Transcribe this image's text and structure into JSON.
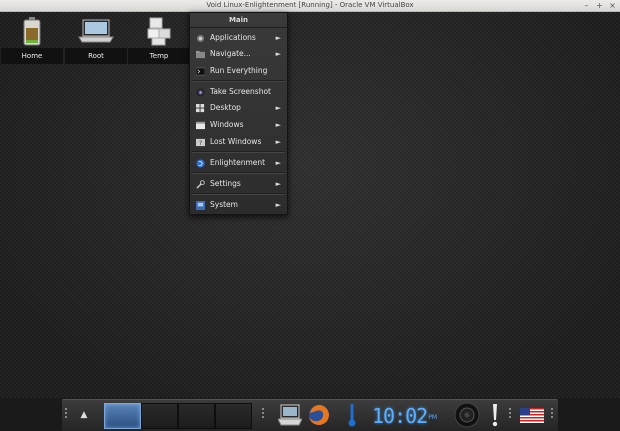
{
  "window": {
    "title": "Void Linux-Enlightenment [Running] - Oracle VM VirtualBox",
    "controls": [
      "–",
      "+",
      "×"
    ]
  },
  "desktop_icons": [
    {
      "label": "Home",
      "icon": "home-battery-icon"
    },
    {
      "label": "Root",
      "icon": "laptop-icon"
    },
    {
      "label": "Temp",
      "icon": "temp-boxes-icon"
    }
  ],
  "menu": {
    "title": "Main",
    "items": [
      {
        "label": "Applications",
        "icon": "applications-icon",
        "arrow": "►"
      },
      {
        "label": "Navigate...",
        "icon": "folder-icon",
        "arrow": "►"
      },
      {
        "label": "Run Everything",
        "icon": "terminal-icon",
        "arrow": ""
      },
      {
        "label": "Take Screenshot",
        "icon": "camera-icon",
        "arrow": ""
      },
      {
        "label": "Desktop",
        "icon": "desktop-grid-icon",
        "arrow": "►"
      },
      {
        "label": "Windows",
        "icon": "windows-icon",
        "arrow": "►"
      },
      {
        "label": "Lost Windows",
        "icon": "lost-windows-icon",
        "arrow": "►"
      },
      {
        "label": "Enlightenment",
        "icon": "enlightenment-icon",
        "arrow": "►"
      },
      {
        "label": "Settings",
        "icon": "wrench-icon",
        "arrow": "►"
      },
      {
        "label": "System",
        "icon": "system-icon",
        "arrow": "►"
      }
    ]
  },
  "shelf": {
    "start_arrow": "▲",
    "pagers": 4,
    "active_pager": 0,
    "clock": {
      "time": "10:02",
      "ampm": "PM"
    },
    "colors": {
      "clock": "#5ab0ff",
      "accent": "#3d7bd6"
    }
  }
}
